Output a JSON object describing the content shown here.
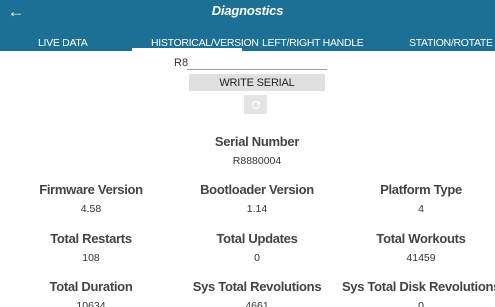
{
  "app": {
    "title": "Diagnostics"
  },
  "tabs": [
    {
      "label": "LIVE DATA"
    },
    {
      "label": "HISTORICAL/VERSION"
    },
    {
      "label": "LEFT/RIGHT HANDLE"
    },
    {
      "label": "STATION/ROTATE"
    }
  ],
  "serial_form": {
    "field_label": "R8",
    "input_value": "",
    "write_button": "WRITE SERIAL"
  },
  "stats": {
    "serial_number": {
      "label": "Serial Number",
      "value": "R8880004"
    },
    "firmware_version": {
      "label": "Firmware Version",
      "value": "4.58"
    },
    "bootloader_version": {
      "label": "Bootloader Version",
      "value": "1.14"
    },
    "platform_type": {
      "label": "Platform Type",
      "value": "4"
    },
    "total_restarts": {
      "label": "Total Restarts",
      "value": "108"
    },
    "total_updates": {
      "label": "Total Updates",
      "value": "0"
    },
    "total_workouts": {
      "label": "Total Workouts",
      "value": "41459"
    },
    "total_duration": {
      "label": "Total Duration",
      "value": "10634"
    },
    "sys_total_revolutions": {
      "label": "Sys Total Revolutions",
      "value": "4661"
    },
    "sys_total_disk_revolutions": {
      "label": "Sys Total Disk Revolutions",
      "value": "0"
    }
  },
  "colors": {
    "appbar": "#1c6f95",
    "label_text": "#444444"
  },
  "icons": {
    "back": "arrow-left-icon",
    "refresh": "refresh-icon"
  }
}
